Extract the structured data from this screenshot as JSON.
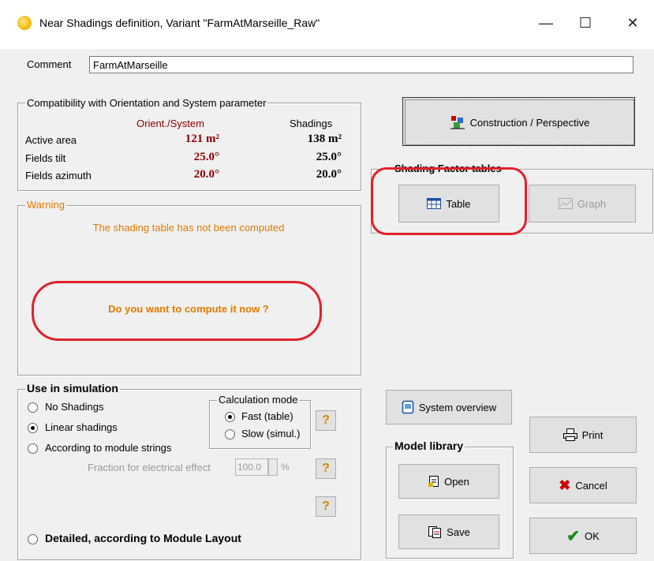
{
  "window": {
    "title": "Near Shadings definition, Variant \"FarmAtMarseille_Raw\"",
    "controls": {
      "minimize": "—",
      "maximize": "☐",
      "close": "✕"
    }
  },
  "comment": {
    "label": "Comment",
    "value": "FarmAtMarseille"
  },
  "compat": {
    "title": "Compatibility with Orientation and System parameter",
    "col_orient": "Orient./System",
    "col_shadings": "Shadings",
    "rows": [
      {
        "label": "Active area",
        "orient": "121 m²",
        "shadings": "138 m²"
      },
      {
        "label": "Fields tilt",
        "orient": "25.0°",
        "shadings": "25.0°"
      },
      {
        "label": "Fields azimuth",
        "orient": "20.0°",
        "shadings": "20.0°"
      }
    ]
  },
  "warning": {
    "title": "Warning",
    "message": "The shading table has not been computed",
    "question": "Do you want to compute it now ?"
  },
  "construction_button": {
    "label": "Construction / Perspective",
    "icon": "construction-icon"
  },
  "shading_factor": {
    "title": "Shading Factor tables",
    "table_label": "Table",
    "graph_label": "Graph"
  },
  "simulation": {
    "title": "Use in simulation",
    "options": [
      {
        "label": "No Shadings",
        "selected": false
      },
      {
        "label": "Linear shadings",
        "selected": true
      },
      {
        "label": "According to module strings",
        "selected": false
      },
      {
        "label": "Detailed, according to Module Layout",
        "selected": false
      }
    ],
    "calc_mode": {
      "title": "Calculation mode",
      "options": [
        {
          "label": "Fast (table)",
          "selected": true
        },
        {
          "label": "Slow (simul.)",
          "selected": false
        }
      ]
    },
    "fraction_label": "Fraction for electrical effect",
    "fraction_value": "100.0",
    "fraction_unit": "%",
    "help": "?"
  },
  "system_overview": {
    "label": "System overview"
  },
  "model_library": {
    "title": "Model library",
    "open_label": "Open",
    "save_label": "Save"
  },
  "actions": {
    "print_label": "Print",
    "cancel_label": "Cancel",
    "ok_label": "OK"
  },
  "colors": {
    "warning": "#e07b00",
    "dark_red": "#8b0000",
    "highlight_ring": "#e0212b"
  }
}
